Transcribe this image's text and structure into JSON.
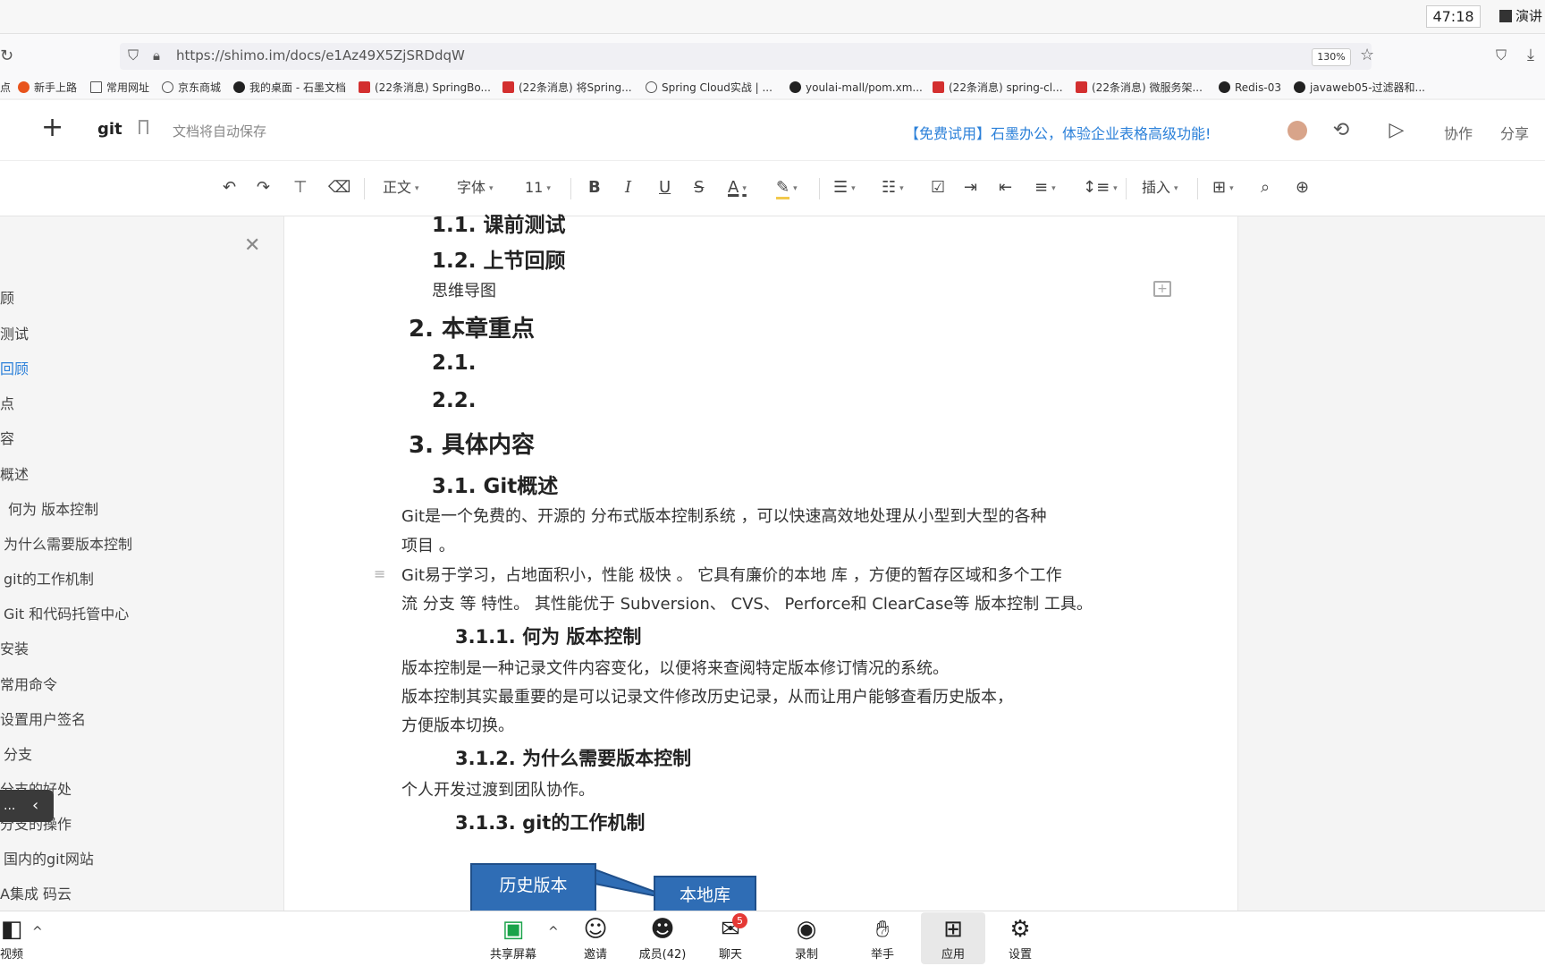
{
  "timer": "47:18",
  "present_label": "演讲",
  "browser": {
    "url": "https://shimo.im/docs/e1Az49X5ZjSRDdqW",
    "zoom": "130%",
    "bookmarks": [
      "点",
      "新手上路",
      "常用网址",
      "京东商城",
      "我的桌面 - 石墨文档",
      "(22条消息) SpringBo...",
      "(22条消息) 将Spring...",
      "Spring Cloud实战 | ...",
      "youlai-mall/pom.xm...",
      "(22条消息) spring-cl...",
      "(22条消息) 微服务架...",
      "Redis-03",
      "javaweb05-过滤器和..."
    ]
  },
  "header": {
    "title": "git",
    "autosave": "文档将自动保存",
    "promo": "【免费试用】石墨办公，体验企业表格高级功能!",
    "collab": "协作",
    "share": "分享"
  },
  "toolbar": {
    "style": "正文",
    "font": "字体",
    "size": "11",
    "insert": "插入",
    "bold": "B",
    "italic": "I",
    "underline": "U",
    "strike": "S",
    "color": "A"
  },
  "sidebar": {
    "items": [
      "顾",
      "测试",
      "回顾",
      "点",
      "容",
      "概述",
      "何为 版本控制",
      "为什么需要版本控制",
      "git的工作机制",
      "Git 和代码托管中心",
      "安装",
      "常用命令",
      "设置用户签名",
      "分支",
      "分支的好处",
      "分支的操作",
      "国内的git网站",
      "A集成 码云"
    ],
    "collapse_dots": "...",
    "collapse_arrow": "‹"
  },
  "doc": {
    "h_1_1": "1.1. 课前测试",
    "h_1_2": "1.2. 上节回顾",
    "mindmap": "思维导图",
    "h_2": "2. 本章重点",
    "h_2_1": "2.1.",
    "h_2_2": "2.2.",
    "h_3": "3. 具体内容",
    "h_3_1": "3.1.  Git概述",
    "p1a": "Git是一个免费的、开源的 分布式版本控制系统 ，可以快速高效地处理从小型到大型的各种",
    "p1b": "项目 。",
    "p2a": "Git易于学习，占地面积小，性能 极快 。 它具有廉价的本地 库 ，方便的暂存区域和多个工作",
    "p2b": "流 分支 等 特性。 其性能优于 Subversion、 CVS、 Perforce和 ClearCase等 版本控制 工具。",
    "h_3_1_1": "3.1.1.   何为 版本控制",
    "p3": "版本控制是一种记录文件内容变化，以便将来查阅特定版本修订情况的系统。",
    "p4a": "版本控制其实最重要的是可以记录文件修改历史记录，从而让用户能够查看历史版本，",
    "p4b": "方便版本切换。",
    "h_3_1_2": "3.1.2.  为什么需要版本控制",
    "p5": "个人开发过渡到团队协作。",
    "h_3_1_3": "3.1.3.  git的工作机制",
    "diagram": {
      "box1": "历史版本",
      "box2": "本地库"
    }
  },
  "meeting": {
    "video": "视频",
    "share_screen": "共享屏幕",
    "invite": "邀请",
    "members": "成员(42)",
    "chat": "聊天",
    "chat_badge": "5",
    "record": "录制",
    "raise_hand": "举手",
    "apps": "应用",
    "settings": "设置"
  }
}
